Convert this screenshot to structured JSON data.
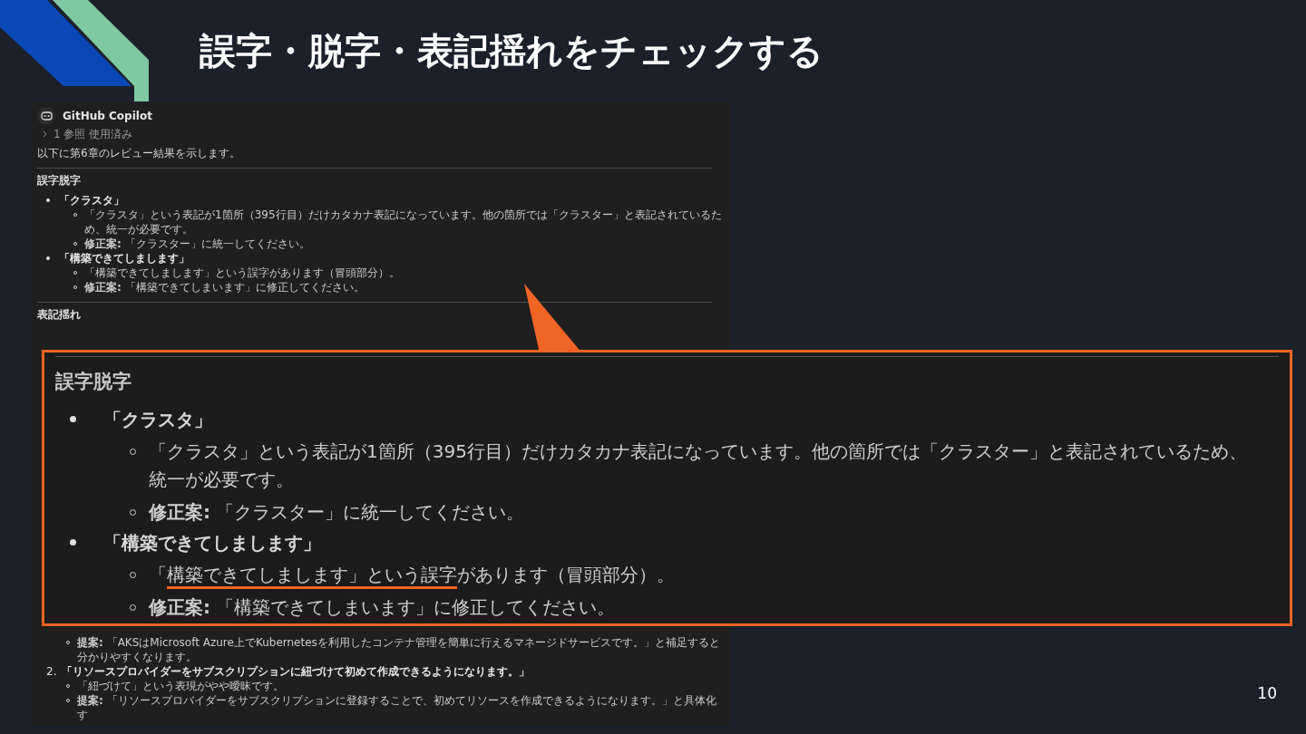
{
  "slide": {
    "title": "誤字・脱字・表記揺れをチェックする",
    "page_number": "10"
  },
  "chat": {
    "author": "GitHub Copilot",
    "references": "1 参照 使用済み",
    "intro": "以下に第6章のレビュー結果を示します。",
    "sections": [
      {
        "heading": "誤字脱字",
        "items": [
          {
            "title": "「クラスタ」",
            "children": [
              {
                "text": "「クラスタ」という表記が1箇所（395行目）だけカタカナ表記になっています。他の箇所では「クラスター」と表記されているため、統一が必要です。"
              },
              {
                "text": "**修正案:** 「クラスター」に統一してください。"
              }
            ]
          },
          {
            "title": "「構築できてしまします」",
            "children": [
              {
                "text": "「構築できてしまします」という誤字があります（冒頭部分）。"
              },
              {
                "text": "**修正案:** 「構築できてしまいます」に修正してください。"
              }
            ]
          }
        ]
      },
      {
        "heading": "表記揺れ"
      }
    ],
    "continuation": [
      {
        "kind": "sub",
        "text": "**提案:** 「AKSはMicrosoft Azure上でKubernetesを利用したコンテナ管理を簡単に行えるマネージドサービスです。」と補足すると分かりやすくなります。"
      },
      {
        "kind": "numbered",
        "number": "2.",
        "text": "「リソースプロバイダーをサブスクリプションに紐づけて初めて作成できるようになります。」"
      },
      {
        "kind": "sub",
        "text": "「紐づけて」という表現がやや曖昧です。"
      },
      {
        "kind": "sub",
        "text": "**提案:** 「リソースプロバイダーをサブスクリプションに登録することで、初めてリソースを作成できるようになります。」と具体化す"
      }
    ]
  },
  "callout": {
    "heading": "誤字脱字",
    "items": [
      {
        "title": "「クラスタ」",
        "children": [
          {
            "segments": [
              {
                "text": "「クラスタ」という表記が1箇所（395行目）だけカタカナ表記になっています。他の箇所では「クラスター」と表記されているため、統一が必要です。",
                "underlined": false
              }
            ]
          },
          {
            "segments": [
              {
                "text": "**修正案:** 「クラスター」に統一してください。",
                "underlined": false
              }
            ]
          }
        ]
      },
      {
        "title": "「構築できてしまします」",
        "children": [
          {
            "segments": [
              {
                "text": "「",
                "underlined": false
              },
              {
                "text": "構築できてしまします」という誤字",
                "underlined": true
              },
              {
                "text": "があります（冒頭部分）。",
                "underlined": false
              }
            ]
          },
          {
            "segments": [
              {
                "text": "**修正案:** 「構築できてしまいます」に修正してください。",
                "underlined": false
              }
            ]
          }
        ]
      }
    ]
  }
}
